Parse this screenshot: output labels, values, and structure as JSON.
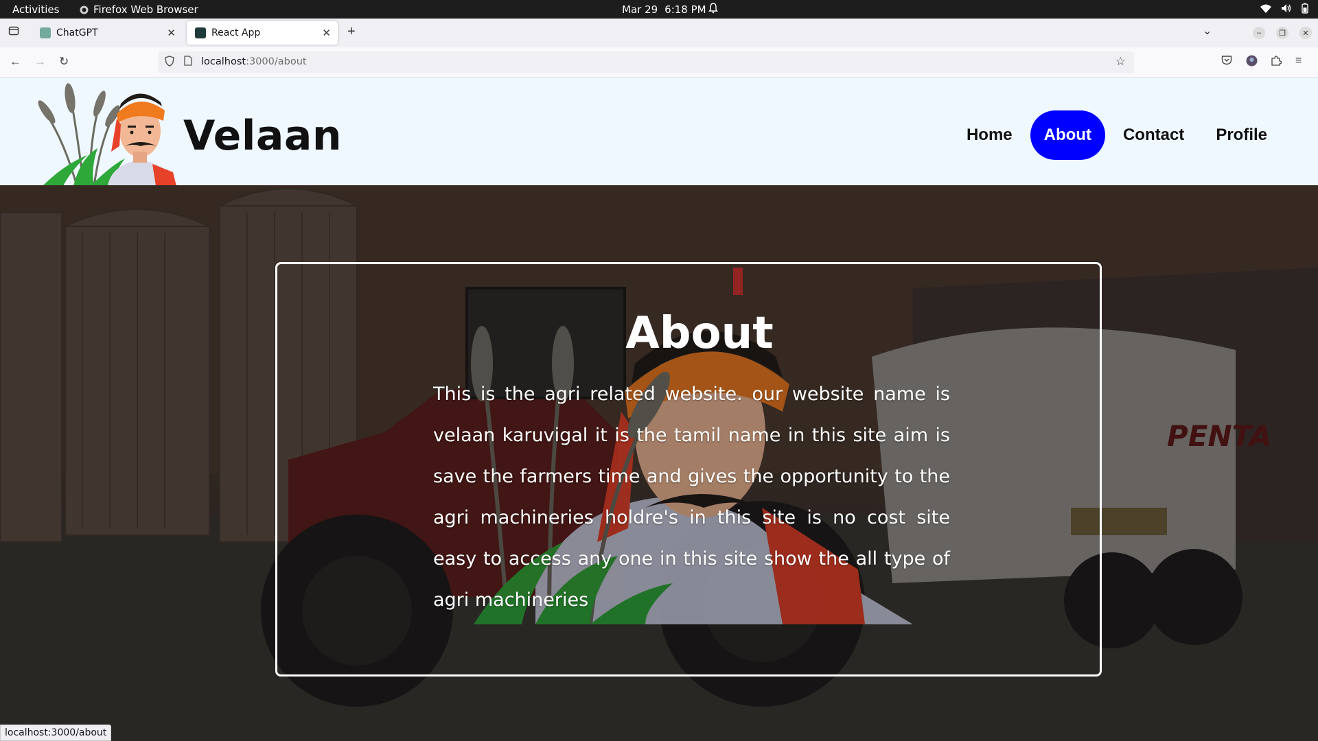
{
  "system_bar": {
    "activities": "Activities",
    "app_name": "Firefox Web Browser",
    "date": "Mar 29",
    "time": "6:18 PM"
  },
  "browser": {
    "tabs": [
      {
        "title": "ChatGPT",
        "active": false
      },
      {
        "title": "React App",
        "active": true
      }
    ],
    "url_host": "localhost",
    "url_path": ":3000/about",
    "status_url": "localhost:3000/about"
  },
  "site": {
    "brand": "Velaan",
    "nav": [
      {
        "label": "Home",
        "active": false
      },
      {
        "label": "About",
        "active": true
      },
      {
        "label": "Contact",
        "active": false
      },
      {
        "label": "Profile",
        "active": false
      }
    ],
    "about_title": "About",
    "about_text": "This is the agri related website. our website name is velaan karuvigal it is the tamil name in this site aim is save the farmers time and gives the opportunity to the agri machineries holdre's in this site is no cost site easy to access any one in this site show the all type of agri machineries",
    "accent_color": "#0000ff",
    "header_bg": "#f0f8ff"
  }
}
